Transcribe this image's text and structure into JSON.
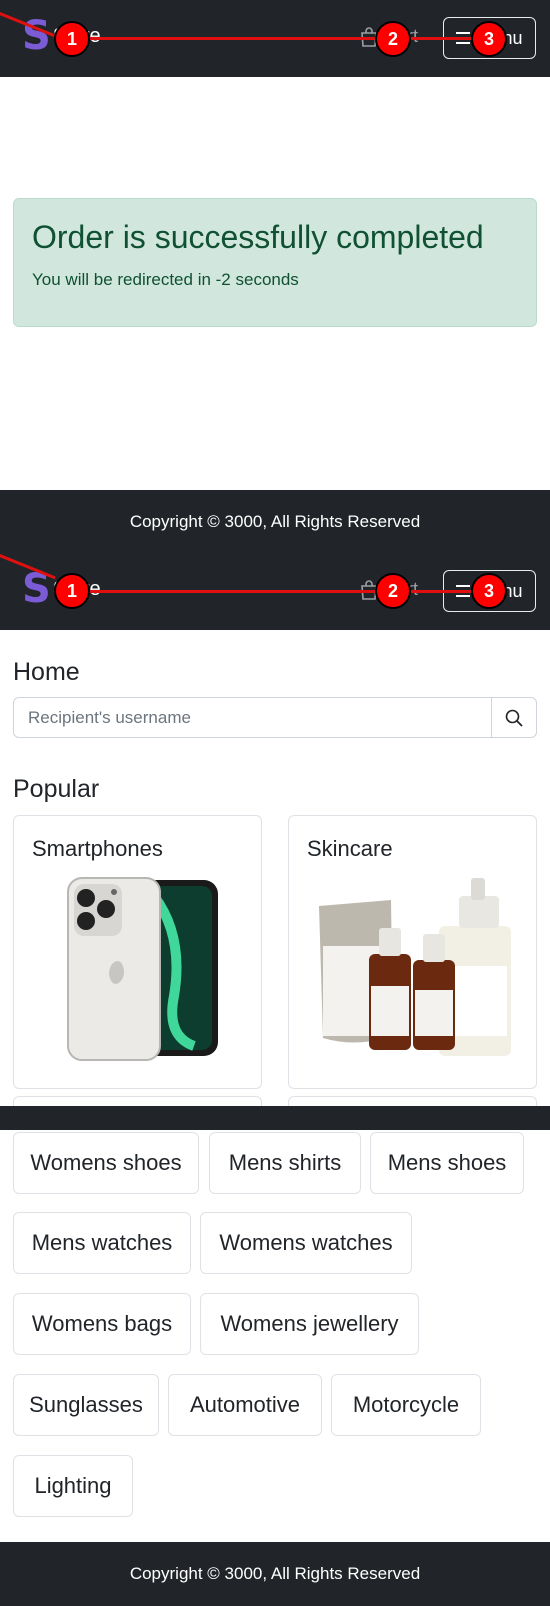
{
  "navbar": {
    "brand_logo": "S",
    "brand_text": "Store",
    "cart_label": "Cart",
    "menu_label": "Menu"
  },
  "alert": {
    "title": "Order is successfully completed",
    "message": "You will be redirected in -2 seconds"
  },
  "footer": {
    "copyright": "Copyright © 3000, All Rights Reserved"
  },
  "home": {
    "title": "Home",
    "search_placeholder": "Recipient's username",
    "popular_title": "Popular",
    "cards": [
      {
        "title": "Smartphones",
        "image_icon": "smartphone-image"
      },
      {
        "title": "Skincare",
        "image_icon": "skincare-image"
      }
    ]
  },
  "categories": [
    "Womens shoes",
    "Mens shirts",
    "Mens shoes",
    "Mens watches",
    "Womens watches",
    "Womens bags",
    "Womens jewellery",
    "Sunglasses",
    "Automotive",
    "Motorcycle",
    "Lighting"
  ],
  "markers": [
    "1",
    "2",
    "3"
  ],
  "colors": {
    "navbar_bg": "#212529",
    "brand_accent": "#7b5cd6",
    "alert_bg": "#d1e7dd",
    "alert_text": "#0f5132",
    "marker": "#ff0000"
  }
}
